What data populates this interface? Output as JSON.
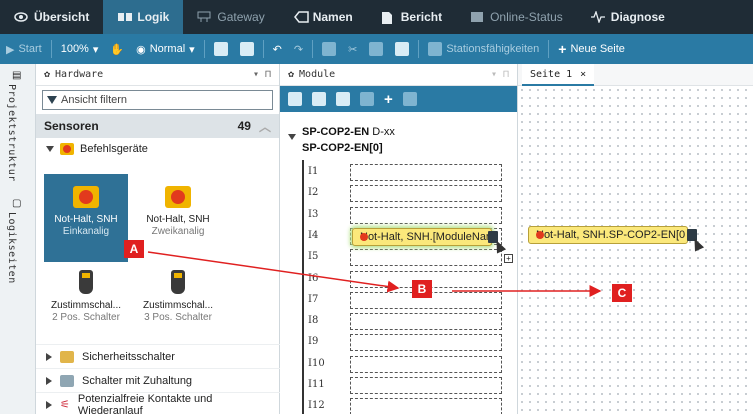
{
  "top_tabs": [
    {
      "label": "Übersicht",
      "icon": "eye-icon"
    },
    {
      "label": "Logik",
      "icon": "logic-icon",
      "active": true
    },
    {
      "label": "Gateway",
      "icon": "gateway-icon"
    },
    {
      "label": "Namen",
      "icon": "tag-icon"
    },
    {
      "label": "Bericht",
      "icon": "document-icon"
    },
    {
      "label": "Online-Status",
      "icon": "status-icon"
    },
    {
      "label": "Diagnose",
      "icon": "diagnose-icon"
    }
  ],
  "toolbar": {
    "start": "Start",
    "zoom": "100%",
    "view_mode": "Normal",
    "station_capability": "Stationsfähigkeiten",
    "new_page": "Neue Seite"
  },
  "side_strip": {
    "projektstruktur": "Projektstruktur",
    "logikseiten": "Logikseiten"
  },
  "hardware": {
    "title": "Hardware",
    "pin": "▾ ⊓",
    "filter_placeholder": "Ansicht filtern",
    "category": "Sensoren",
    "category_count": "49",
    "subcategory": "Befehlsgeräte",
    "tiles": [
      {
        "name": "Not-Halt, SNH",
        "sub": "Einkanalig"
      },
      {
        "name": "Not-Halt, SNH",
        "sub": "Zweikanalig"
      },
      {
        "name": "Zustimmschal...",
        "sub": "2 Pos. Schalter"
      },
      {
        "name": "Zustimmschal...",
        "sub": "3 Pos. Schalter"
      }
    ],
    "groups": [
      "Sicherheitsschalter",
      "Schalter mit Zuhaltung",
      "Potenzialfreie Kontakte und Wiederanlauf"
    ]
  },
  "module": {
    "title": "Module",
    "header1_bold": "SP-COP2-EN",
    "header1_tail": " D-xx",
    "header2": "SP-COP2-EN[0]",
    "slots": [
      "I1",
      "I2",
      "I3",
      "I4",
      "I5",
      "I6",
      "I7",
      "I8",
      "I9",
      "I10",
      "I11",
      "I12"
    ],
    "dragged_chip": "Not-Halt, SNH.[ModuleName]"
  },
  "page": {
    "tab": "Seite 1",
    "close": "×",
    "chip": "Not-Halt, SNH.SP-COP2-EN[0"
  },
  "markers": {
    "a": "A",
    "b": "B",
    "c": "C"
  }
}
